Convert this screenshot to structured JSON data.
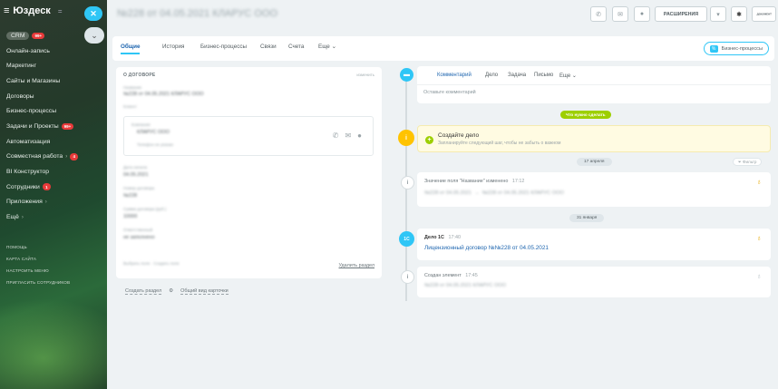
{
  "sidebar": {
    "brand": "Юздеск",
    "crm_label": "CRM",
    "crm_badge": "99+",
    "items": [
      {
        "label": "Онлайн-запись"
      },
      {
        "label": "Маркетинг"
      },
      {
        "label": "Сайты и Магазины"
      },
      {
        "label": "Договоры"
      },
      {
        "label": "Бизнес-процессы"
      },
      {
        "label": "Задачи и Проекты",
        "badge": "99+"
      },
      {
        "label": "Автоматизация"
      },
      {
        "label": "Совместная работа",
        "badge": "4"
      },
      {
        "label": "BI Конструктор"
      },
      {
        "label": "Сотрудники",
        "badge": "1"
      },
      {
        "label": "Приложения"
      },
      {
        "label": "Ещё"
      }
    ],
    "footer": [
      "ПОМОЩЬ",
      "КАРТА САЙТА",
      "НАСТРОИТЬ МЕНЮ",
      "ПРИГЛАСИТЬ СОТРУДНИКОВ"
    ]
  },
  "topbar": {
    "title": "№228 от 04.05.2021 КЛАРУС ООО",
    "extensions": "РАСШИРЕНИЯ",
    "document": "ДОКУМЕНТ"
  },
  "tabs": [
    "Общие",
    "История",
    "Бизнес-процессы",
    "Связи",
    "Счета",
    "Еще"
  ],
  "bp_button": "Бизнес-процессы",
  "about": {
    "title": "О ДОГОВОРЕ",
    "edit": "изменить",
    "delete": "Удалить раздел",
    "create_section": "Создать раздел",
    "common_view": "Общий вид карточки"
  },
  "comment": {
    "tabs": [
      "Комментарий",
      "Дело",
      "Задача",
      "Письмо",
      "Еще"
    ],
    "hint": "Оставьте комментарий"
  },
  "what_todo": "Что нужно сделать",
  "todo": {
    "title": "Создайте дело",
    "subtitle": "Запланируйте следующий шаг, чтобы не забыть о важном"
  },
  "dates": {
    "first": "17 апреля",
    "second": "31 января"
  },
  "filter": "Фильтр",
  "events": {
    "changed": {
      "text": "Значение поля \"Название\" изменено",
      "time": "17:12"
    },
    "deal": {
      "head": "Дело 1С",
      "time": "17:40",
      "link": "Лицензионный договор №№228 от 04.05.2021",
      "dot": "1С"
    },
    "created": {
      "text": "Создан элемент",
      "time": "17:45"
    }
  },
  "colors": {
    "accent": "#2fc6f6",
    "link": "#2067b0",
    "green": "#9dcf00",
    "yellow": "#ffc300",
    "badge": "#e83a3a"
  }
}
